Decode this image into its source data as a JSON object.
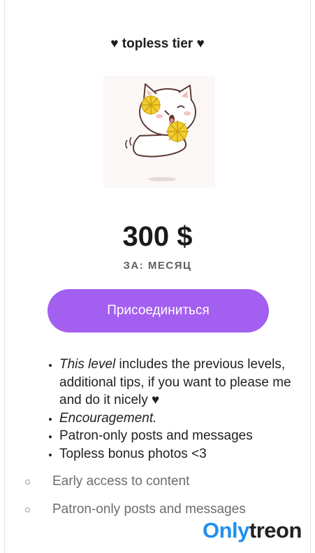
{
  "tier": {
    "title": "♥ topless tier ♥",
    "price": "300 $",
    "period": "ЗА: МЕСЯЦ",
    "join_label": "Присоединиться"
  },
  "benefits": [
    {
      "italic": "This level",
      "rest": " includes the previous levels, additional tips, if you want to please me and do it nicely ♥"
    },
    {
      "italic": "Encouragement.",
      "rest": ""
    },
    {
      "italic": "",
      "rest": "Patron-only posts and messages"
    },
    {
      "italic": "",
      "rest": "Topless bonus photos <3"
    }
  ],
  "sub_benefits": [
    "Early access to content",
    "Patron-only posts and messages"
  ],
  "watermark": {
    "part1": "Only",
    "part2": "treon"
  },
  "colors": {
    "accent": "#a35ff0",
    "brand_blue": "#1f8ff0"
  }
}
